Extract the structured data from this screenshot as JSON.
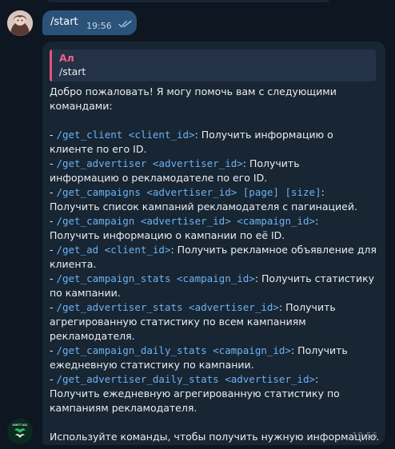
{
  "chat": {
    "outgoing": {
      "text": "/start",
      "time": "19:56",
      "status_icon": "double-check-icon"
    },
    "incoming": {
      "reply": {
        "name": "Ал",
        "text": "/start"
      },
      "intro_line1": "Добро пожаловать! Я могу помочь вам с следующими",
      "intro_line2": "командами:",
      "commands": {
        "get_client_cmd": "/get_client <client_id>",
        "get_client_desc": ": Получить информацию о",
        "get_client_desc2": "клиенте по его ID.",
        "get_advertiser_cmd": "/get_advertiser <advertiser_id>",
        "get_advertiser_desc": ": Получить",
        "get_advertiser_desc2": "информацию о рекламодателе по его ID.",
        "get_campaigns_cmd": "/get_campaigns <advertiser_id> [page] [size]",
        "get_campaigns_desc": ":",
        "get_campaigns_desc2": "Получить список кампаний рекламодателя с пагинацией.",
        "get_campaign_cmd": "/get_campaign <advertiser_id> <campaign_id>",
        "get_campaign_desc": ":",
        "get_campaign_desc2": "Получить информацию о кампании по её ID.",
        "get_ad_cmd": "/get_ad <client_id>",
        "get_ad_desc": ": Получить рекламное объявление для",
        "get_ad_desc2": "клиента.",
        "get_campaign_stats_cmd": "/get_campaign_stats <campaign_id>",
        "get_campaign_stats_desc": ": Получить статистику",
        "get_campaign_stats_desc2": "по кампании.",
        "get_advertiser_stats_cmd": "/get_advertiser_stats <advertiser_id>",
        "get_advertiser_stats_desc": ": Получить",
        "get_advertiser_stats_desc2": "агрегированную статистику по всем кампаниям рекламодателя.",
        "get_campaign_daily_stats_cmd": "/get_campaign_daily_stats <campaign_id>",
        "get_campaign_daily_stats_desc": ": Получить",
        "get_campaign_daily_stats_desc2": "ежедневную статистику по кампании.",
        "get_advertiser_daily_stats_cmd": "/get_advertiser_daily_stats <advertiser_id>",
        "get_advertiser_daily_stats_desc": ":",
        "get_advertiser_daily_stats_desc2": "Получить ежедневную агрегированную статистику по",
        "get_advertiser_daily_stats_desc3": "кампаниям рекламодателя."
      },
      "outro": "Используйте команды, чтобы получить нужную информацию.",
      "time": "19:56"
    },
    "bot_avatar_label": "AKKITT AOL"
  },
  "colors": {
    "background": "#0e1621",
    "outgoing_bubble": "#2b5278",
    "incoming_bubble": "#182533",
    "link": "#6ab3f3",
    "reply_accent": "#e2557a"
  }
}
